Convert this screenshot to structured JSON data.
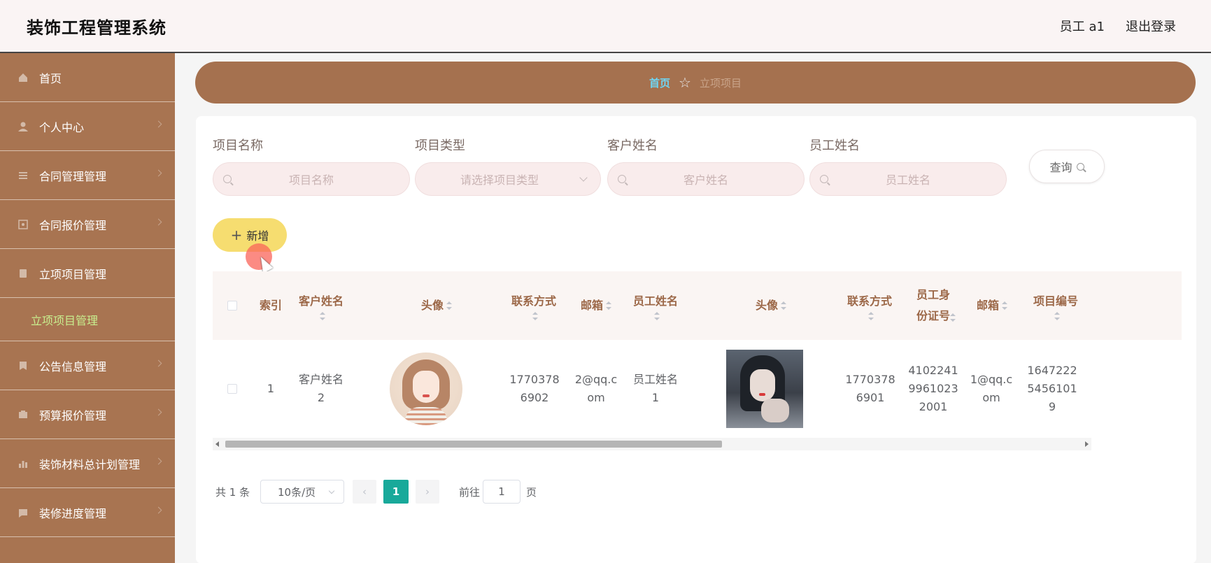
{
  "header": {
    "app_title": "装饰工程管理系统",
    "user_label": "员工 a1",
    "logout_label": "退出登录"
  },
  "sidebar": {
    "items": [
      {
        "label": "首页",
        "icon": "home-icon"
      },
      {
        "label": "个人中心",
        "icon": "user-icon"
      },
      {
        "label": "合同管理管理",
        "icon": "contract-icon"
      },
      {
        "label": "合同报价管理",
        "icon": "quote-icon"
      },
      {
        "label": "立项项目管理",
        "icon": "project-icon"
      },
      {
        "label": "公告信息管理",
        "icon": "notice-icon"
      },
      {
        "label": "预算报价管理",
        "icon": "budget-icon"
      },
      {
        "label": "装饰材料总计划管理",
        "icon": "material-icon"
      },
      {
        "label": "装修进度管理",
        "icon": "progress-icon"
      }
    ],
    "active_submenu": "立项项目管理"
  },
  "breadcrumb": {
    "home": "首页",
    "current": "立项项目"
  },
  "search": {
    "fields": [
      {
        "label": "项目名称",
        "placeholder": "项目名称"
      },
      {
        "label": "项目类型",
        "placeholder": "请选择项目类型"
      },
      {
        "label": "客户姓名",
        "placeholder": "客户姓名"
      },
      {
        "label": "员工姓名",
        "placeholder": "员工姓名"
      }
    ],
    "query_label": "查询"
  },
  "add_label": "新增",
  "table": {
    "columns": [
      "索引",
      "客户姓名",
      "头像",
      "联系方式",
      "邮箱",
      "员工姓名",
      "头像",
      "联系方式",
      "员工身份证号",
      "邮箱",
      "项目编号"
    ],
    "rows": [
      {
        "index": "1",
        "customer_name": "客户姓名2",
        "customer_phone": "17703786902",
        "customer_email": "2@qq.com",
        "staff_name": "员工姓名1",
        "staff_phone": "17703786901",
        "staff_id": "410224199610232001",
        "staff_email": "1@qq.com",
        "project_no": "16472225456101 9"
      }
    ]
  },
  "pagination": {
    "total": "共 1 条",
    "page_size": "10条/页",
    "current_page": "1",
    "goto_prefix": "前往",
    "goto_value": "1",
    "goto_suffix": "页"
  },
  "colors": {
    "sidebar_bg": "#a87451",
    "breadcrumb_bg": "#a5714f",
    "header_bg": "#faf4f4",
    "active_submenu": "#c8ef8f",
    "add_button": "#f6dd70",
    "page_active": "#18a99a"
  }
}
